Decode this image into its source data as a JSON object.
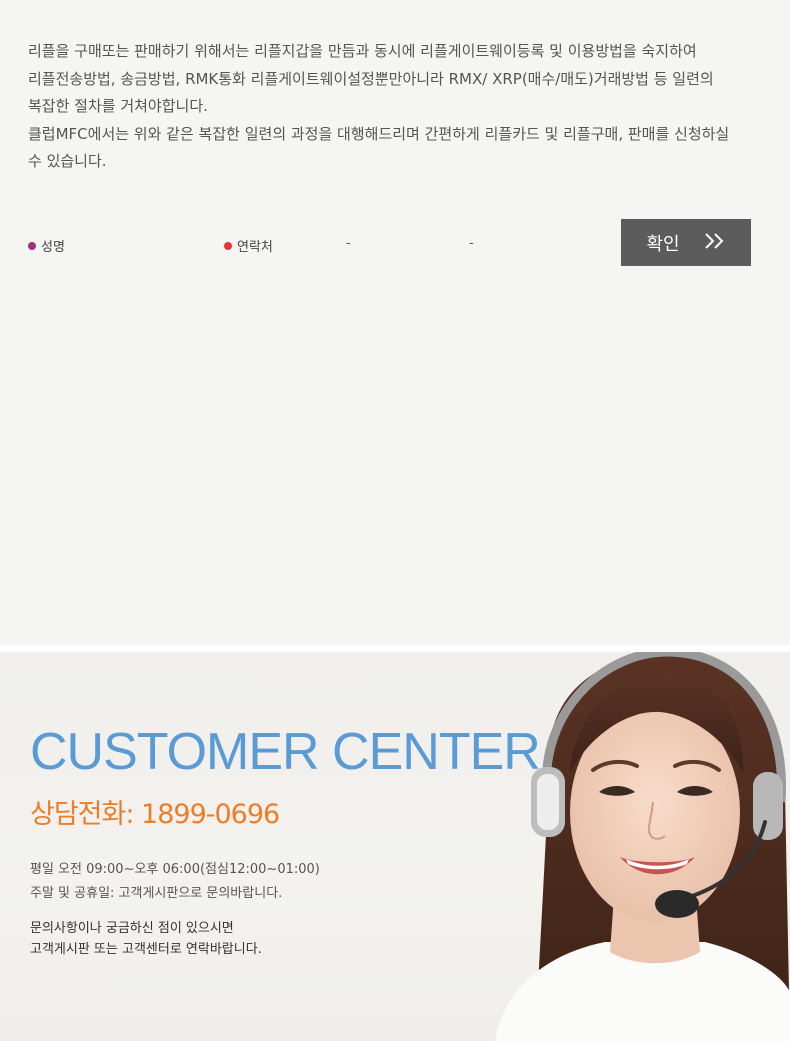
{
  "intro": {
    "lines": [
      "리플을 구매또는 판매하기 위해서는 리플지갑을 만듬과 동시에 리플게이트웨이등록 및 이용방법을 숙지하여",
      "리플전송방법, 송금방법, RMK통화 리플게이트웨이설정뿐만아니라 RMX/ XRP(매수/매도)거래방법 등 일련의",
      "복잡한 절차를 거쳐야합니다.",
      "클럽MFC에서는 위와 같은 복잡한 일련의 과정을 대행해드리며 간편하게 리플카드 및 리플구매, 판매를 신청하실",
      "수 있습니다."
    ]
  },
  "form": {
    "name_label": "성명",
    "contact_label": "연락처",
    "dash": "-",
    "confirm_label": "확인",
    "confirm_icon": "double-chevron-right-icon",
    "name_dot_color": "#a0327a",
    "contact_dot_color": "#e8353a"
  },
  "customer_center": {
    "title": "CUSTOMER CENTER",
    "phone": "상담전화: 1899-0696",
    "hours": [
      "평일 오전 09:00~오후 06:00(점심12:00~01:00)",
      "주말 및 공휴일: 고객게시판으로 문의바랍니다."
    ],
    "note": [
      "문의사항이나 궁금하신 점이 있으시면",
      "고객게시판 또는 고객센터로 연락바랍니다."
    ],
    "title_color": "#5b9bd5",
    "phone_color": "#ee7d28"
  }
}
